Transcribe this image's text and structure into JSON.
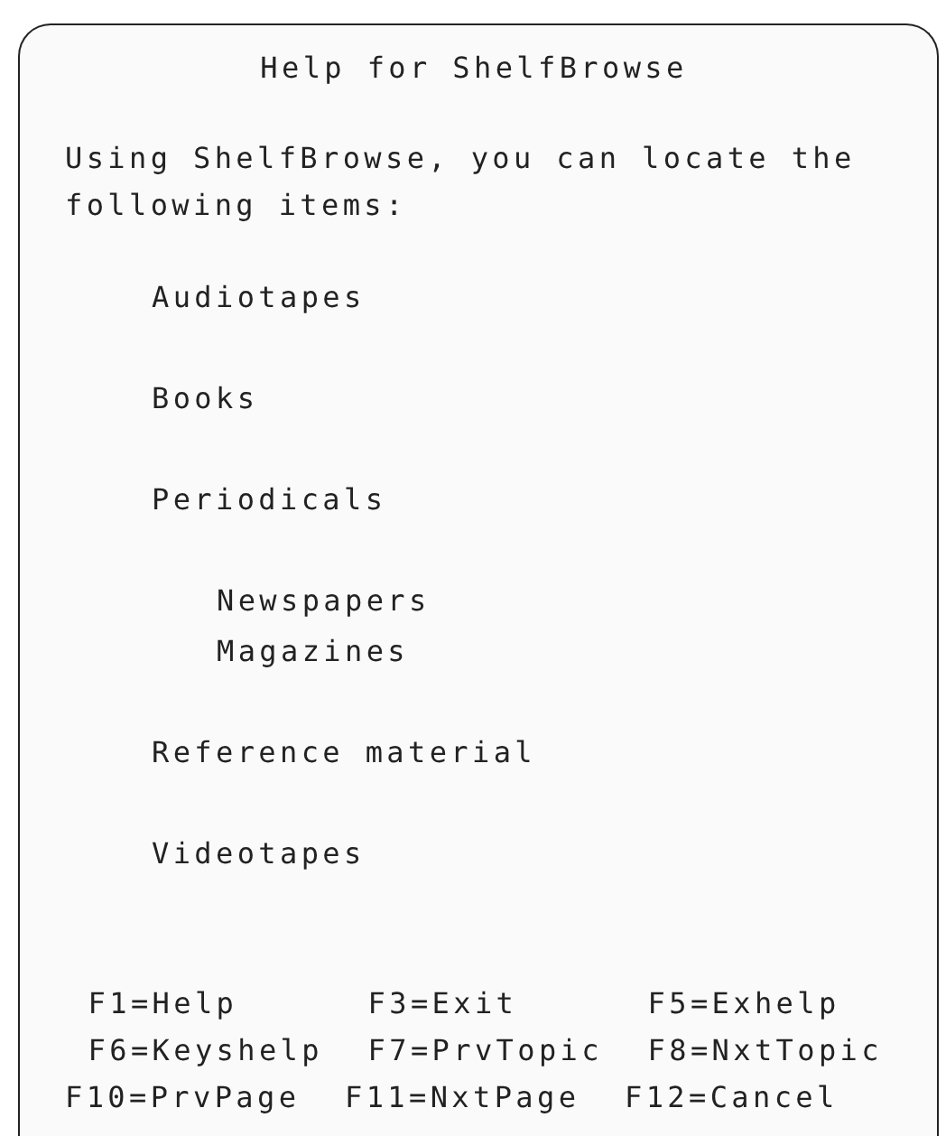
{
  "title": "Help for ShelfBrowse",
  "intro": "Using ShelfBrowse, you can locate the following items:",
  "items": [
    {
      "label": "Audiotapes"
    },
    {
      "label": "Books"
    },
    {
      "label": "Periodicals",
      "children": [
        {
          "label": "Newspapers"
        },
        {
          "label": "Magazines"
        }
      ]
    },
    {
      "label": "Reference material"
    },
    {
      "label": "Videotapes"
    }
  ],
  "function_keys": [
    [
      "F1=Help",
      "F3=Exit",
      "F5=Exhelp"
    ],
    [
      "F6=Keyshelp",
      "F7=PrvTopic",
      "F8=NxtTopic"
    ],
    [
      "F10=PrvPage",
      "F11=NxtPage",
      "F12=Cancel"
    ]
  ]
}
